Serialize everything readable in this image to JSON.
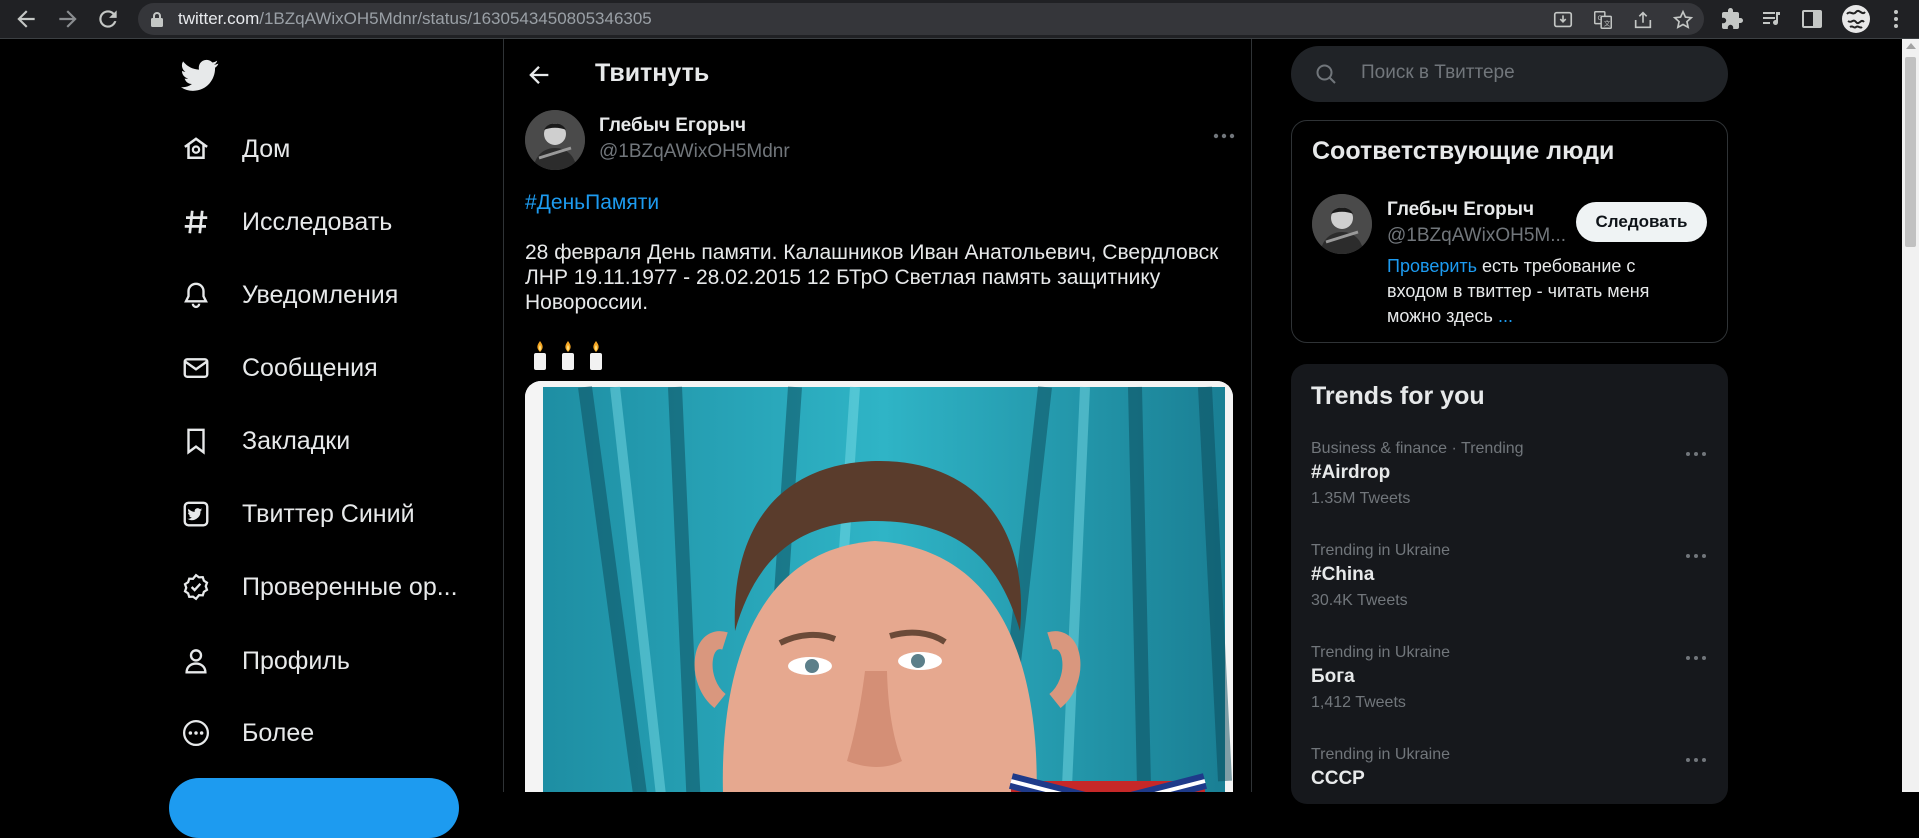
{
  "browser": {
    "url_domain": "twitter.com",
    "url_path": "/1BZqAWixOH5Mdnr/status/1630543450805346305",
    "icons": [
      "back-icon",
      "forward-icon",
      "reload-icon",
      "lock-icon",
      "install-icon",
      "translate-icon",
      "share-icon",
      "star-icon",
      "extensions-icon",
      "media-icon",
      "sidepanel-icon",
      "profile-icon",
      "menu-icon"
    ]
  },
  "sidebar": {
    "logo": "twitter-logo-icon",
    "items": [
      {
        "label": "Дом",
        "icon": "home-icon"
      },
      {
        "label": "Исследовать",
        "icon": "hashtag-icon"
      },
      {
        "label": "Уведомления",
        "icon": "bell-icon"
      },
      {
        "label": "Сообщения",
        "icon": "envelope-icon"
      },
      {
        "label": "Закладки",
        "icon": "bookmark-icon"
      },
      {
        "label": "Твиттер Синий",
        "icon": "twitter-blue-icon"
      },
      {
        "label": "Проверенные ор...",
        "icon": "verified-org-icon"
      },
      {
        "label": "Профиль",
        "icon": "person-icon"
      },
      {
        "label": "Более",
        "icon": "more-circle-icon"
      }
    ]
  },
  "main": {
    "title": "Твитнуть",
    "tweet": {
      "author_name": "Глебыч Егорыч",
      "author_handle": "@1BZqAWixOH5Mdnr",
      "hashtag": "#ДеньПамяти",
      "text_line1": "28 февраля День памяти. Калашников Иван Анатольевич, Свердловск",
      "text_line2": "ЛНР 19.11.1977 - 28.02.2015 12 БТрО Светлая память защитнику",
      "text_line3": "Новороссии.",
      "emoji": "🕯🕯🕯"
    }
  },
  "right": {
    "search_placeholder": "Поиск в Твиттере",
    "people": {
      "title": "Соответствующие люди",
      "name": "Глебыч Егорыч",
      "handle": "@1BZqAWixOH5M...",
      "follow_label": "Следовать",
      "bio_link": "Проверить",
      "bio_text": " есть требование с входом в твиттер - читать меня можно здесь ",
      "bio_more": "..."
    },
    "trends": {
      "title": "Trends for you",
      "items": [
        {
          "context": "Business & finance · Trending",
          "name": "#Airdrop",
          "count": "1.35M Tweets"
        },
        {
          "context": "Trending in Ukraine",
          "name": "#China",
          "count": "30.4K Tweets"
        },
        {
          "context": "Trending in Ukraine",
          "name": "Бога",
          "count": "1,412 Tweets"
        },
        {
          "context": "Trending in Ukraine",
          "name": "СССР",
          "count": ""
        }
      ]
    }
  },
  "colors": {
    "accent": "#1d9bf0",
    "background": "#000000",
    "text": "#e7e9ea",
    "muted": "#71767b"
  }
}
